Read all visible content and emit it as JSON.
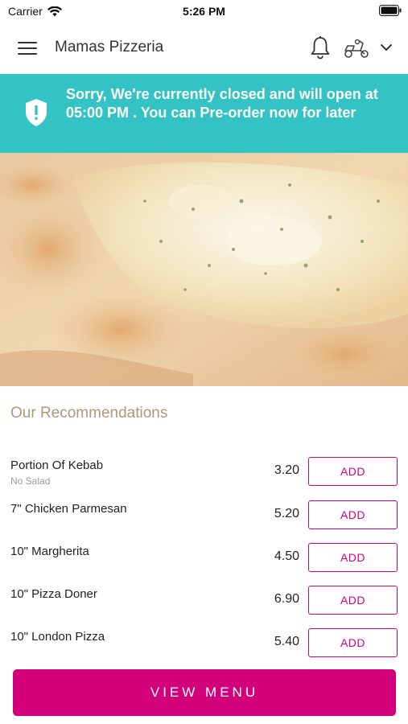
{
  "status_bar": {
    "carrier": "Carrier",
    "time": "5:26 PM"
  },
  "header": {
    "title": "Mamas Pizzeria",
    "menu_icon": "hamburger-icon",
    "notification_icon": "bell-icon",
    "delivery_icon": "scooter-icon",
    "dropdown_icon": "chevron-down-icon"
  },
  "banner": {
    "text": "Sorry, We're currently closed and will open at 05:00 PM . You can Pre-order now for later",
    "icon": "shield-alert-icon",
    "color": "#33c3c4"
  },
  "recommendations": {
    "title": "Our Recommendations",
    "items": [
      {
        "name": "Portion Of Kebab",
        "note": "No Salad",
        "price": "3.20",
        "action": "ADD"
      },
      {
        "name": "7\" Chicken Parmesan",
        "note": "",
        "price": "5.20",
        "action": "ADD"
      },
      {
        "name": "10\" Margherita",
        "note": "",
        "price": "4.50",
        "action": "ADD"
      },
      {
        "name": "10\" Pizza Doner",
        "note": "",
        "price": "6.90",
        "action": "ADD"
      },
      {
        "name": "10\" London Pizza",
        "note": "",
        "price": "5.40",
        "action": "ADD"
      }
    ]
  },
  "footer": {
    "view_menu_label": "VIEW MENU",
    "accent_color": "#d3007b"
  }
}
